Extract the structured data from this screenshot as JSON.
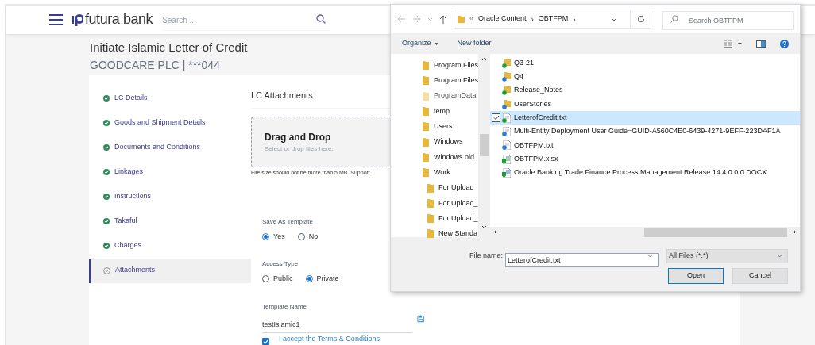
{
  "header": {
    "brand": "futura bank",
    "search": {
      "placeholder": "Search ..."
    }
  },
  "page": {
    "title": "Initiate Islamic Letter of Credit",
    "subtitle": "GOODCARE PLC | ***044"
  },
  "steps": [
    {
      "label": "LC Details",
      "done": true,
      "selected": false
    },
    {
      "label": "Goods and Shipment Details",
      "done": true,
      "selected": false
    },
    {
      "label": "Documents and Conditions",
      "done": true,
      "selected": false
    },
    {
      "label": "Linkages",
      "done": true,
      "selected": false
    },
    {
      "label": "Instructions",
      "done": true,
      "selected": false
    },
    {
      "label": "Takaful",
      "done": true,
      "selected": false
    },
    {
      "label": "Charges",
      "done": true,
      "selected": false
    },
    {
      "label": "Attachments",
      "done": false,
      "selected": true
    }
  ],
  "attachments": {
    "heading": "LC Attachments",
    "drop_title": "Drag and Drop",
    "drop_hint": "Select or drop files here.",
    "note": "File size should not be more than 5 MB. Support"
  },
  "save_as_template": {
    "label": "Save As Template",
    "options": [
      {
        "label": "Yes",
        "selected": true
      },
      {
        "label": "No",
        "selected": false
      }
    ]
  },
  "access_type": {
    "label": "Access Type",
    "options": [
      {
        "label": "Public",
        "selected": false
      },
      {
        "label": "Private",
        "selected": true
      }
    ]
  },
  "template_name": {
    "label": "Template Name",
    "value": "testIslamic1"
  },
  "terms": {
    "label": "I accept the Terms & Conditions",
    "checked": true
  },
  "dialog": {
    "path": [
      "«",
      "Oracle Content",
      "›",
      "OBTFPM",
      "›"
    ],
    "search": {
      "placeholder": "Search OBTFPM"
    },
    "commands": [
      "Organize",
      "New folder"
    ],
    "tree": [
      {
        "name": "Program Files"
      },
      {
        "name": "Program Files"
      },
      {
        "name": "ProgramData",
        "hidden": true
      },
      {
        "name": "temp"
      },
      {
        "name": "Users"
      },
      {
        "name": "Windows"
      },
      {
        "name": "Windows.old"
      },
      {
        "name": "Work",
        "children": [
          {
            "name": "For Upload"
          },
          {
            "name": "For Upload_"
          },
          {
            "name": "For Upload_"
          },
          {
            "name": "New Standa"
          }
        ]
      }
    ],
    "files": [
      {
        "name": "Q3-21",
        "kind": "folder",
        "color": "#1a9e3a",
        "selected": false,
        "checked": false
      },
      {
        "name": "Q4",
        "kind": "folder",
        "color": "#2b7cd3",
        "selected": false,
        "checked": false
      },
      {
        "name": "Release_Notes",
        "kind": "folder",
        "color": "#1a9e3a",
        "selected": false,
        "checked": false
      },
      {
        "name": "UserStories",
        "kind": "folder",
        "color": "#2b7cd3",
        "selected": false,
        "checked": false
      },
      {
        "name": "LetterofCredit.txt",
        "kind": "text",
        "color": "#1a9e3a",
        "selected": true,
        "checked": true
      },
      {
        "name": "Multi-Entity Deployment User Guide=GUID-A560C4E0-6439-4271-9EFF-223DAF1A",
        "kind": "text",
        "color": "#2b7cd3",
        "selected": false,
        "checked": false
      },
      {
        "name": "OBTFPM.txt",
        "kind": "text",
        "color": "#2b7cd3",
        "selected": false,
        "checked": false
      },
      {
        "name": "OBTFPM.xlsx",
        "kind": "sheet",
        "color": "#1a9e3a",
        "selected": false,
        "checked": false
      },
      {
        "name": "Oracle Banking Trade Finance Process Management Release 14.4.0.0.0.DOCX",
        "kind": "doc",
        "color": "#1a9e3a",
        "selected": false,
        "checked": false
      }
    ],
    "file_name": {
      "label": "File name:",
      "value": "LetterofCredit.txt"
    },
    "file_type": "All Files (*.*)",
    "buttons": [
      {
        "label": "Open",
        "default": true
      },
      {
        "label": "Cancel",
        "default": false
      }
    ]
  }
}
